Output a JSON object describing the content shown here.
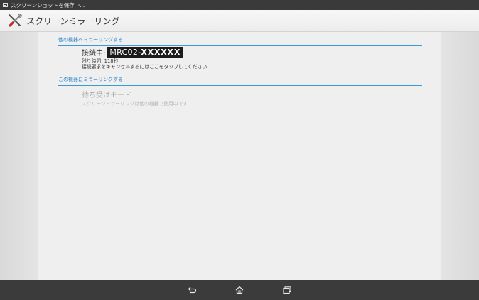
{
  "status_bar": {
    "notification": "スクリーンショットを保存中..."
  },
  "action_bar": {
    "title": "スクリーンミラーリング",
    "icon": "tools-icon"
  },
  "sections": {
    "other_device_header": "他の機器へミラーリングする",
    "connection": {
      "label": "接続中:",
      "device_prefix": "MRC02-",
      "device_id": "XXXXXX",
      "remaining_time": "残り時間: 118秒",
      "cancel_hint": "接続要求をキャンセルするにはここをタップしてください"
    },
    "this_device_header": "この機器にミラーリングする",
    "standby": {
      "title": "待ち受けモード",
      "subtitle": "スクリーンミラーリングは他の機器で使用中です"
    }
  },
  "nav_bar": {
    "icons": [
      "back-icon",
      "home-icon",
      "recent-apps-icon"
    ]
  },
  "colors": {
    "accent": "#3b9ad9",
    "statusbar": "#3a3a3a",
    "navbar": "#3b3b3b"
  }
}
